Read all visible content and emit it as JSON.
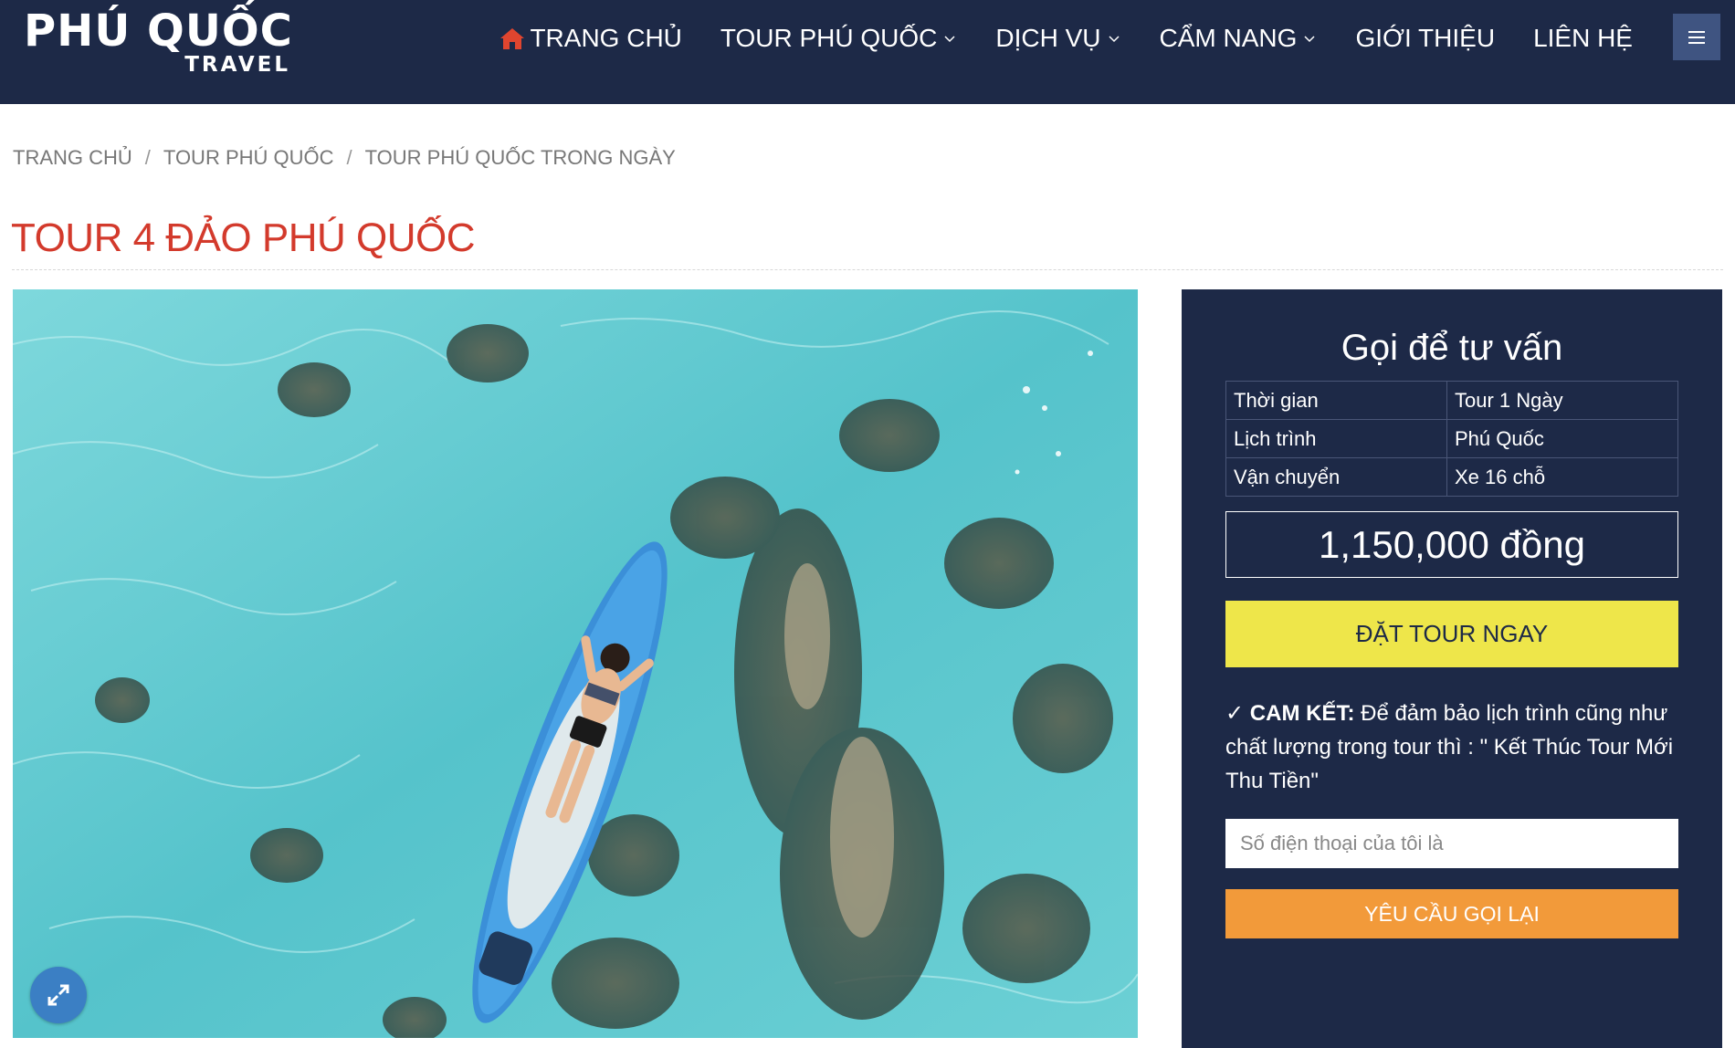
{
  "header": {
    "logo_main": "PHÚ QUỐC",
    "logo_sub": "TRAVEL",
    "nav": [
      {
        "label": "TRANG CHỦ",
        "icon": "home-icon",
        "has_dropdown": false
      },
      {
        "label": "TOUR PHÚ QUỐC",
        "has_dropdown": true
      },
      {
        "label": "DỊCH VỤ",
        "has_dropdown": true
      },
      {
        "label": "CẨM NANG",
        "has_dropdown": true
      },
      {
        "label": "GIỚI THIỆU",
        "has_dropdown": false
      },
      {
        "label": "LIÊN HỆ",
        "has_dropdown": false
      }
    ],
    "menu_icon": "hamburger-menu-icon"
  },
  "breadcrumb": [
    "TRANG CHỦ",
    "TOUR PHÚ QUỐC",
    "TOUR PHÚ QUỐC TRONG NGÀY"
  ],
  "page": {
    "title": "TOUR 4 ĐẢO PHÚ QUỐC"
  },
  "hero": {
    "zoom_icon": "expand-icon"
  },
  "sidebar": {
    "title": "Gọi để tư vấn",
    "info": [
      {
        "label": "Thời gian",
        "value": "Tour 1 Ngày"
      },
      {
        "label": "Lịch trình",
        "value": "Phú Quốc"
      },
      {
        "label": "Vận chuyển",
        "value": "Xe 16 chỗ"
      }
    ],
    "price": "1,150,000 đồng",
    "book_button": "ĐẶT TOUR NGAY",
    "commit_label": "✓ CAM KẾT:",
    "commit_text": " Để đảm bảo lịch trình cũng như chất lượng trong tour thì : \" Kết Thúc Tour Mới Thu Tiền\"",
    "phone_placeholder": "Số điện thoại của tôi là",
    "call_button": "YÊU CẦU GỌI LẠI"
  },
  "colors": {
    "header_bg": "#1d2947",
    "title_red": "#d33a2c",
    "book_yellow": "#eee64a",
    "call_orange": "#f29a3a",
    "menu_btn": "#3f5481",
    "zoom_blue": "#3b7fc4"
  }
}
